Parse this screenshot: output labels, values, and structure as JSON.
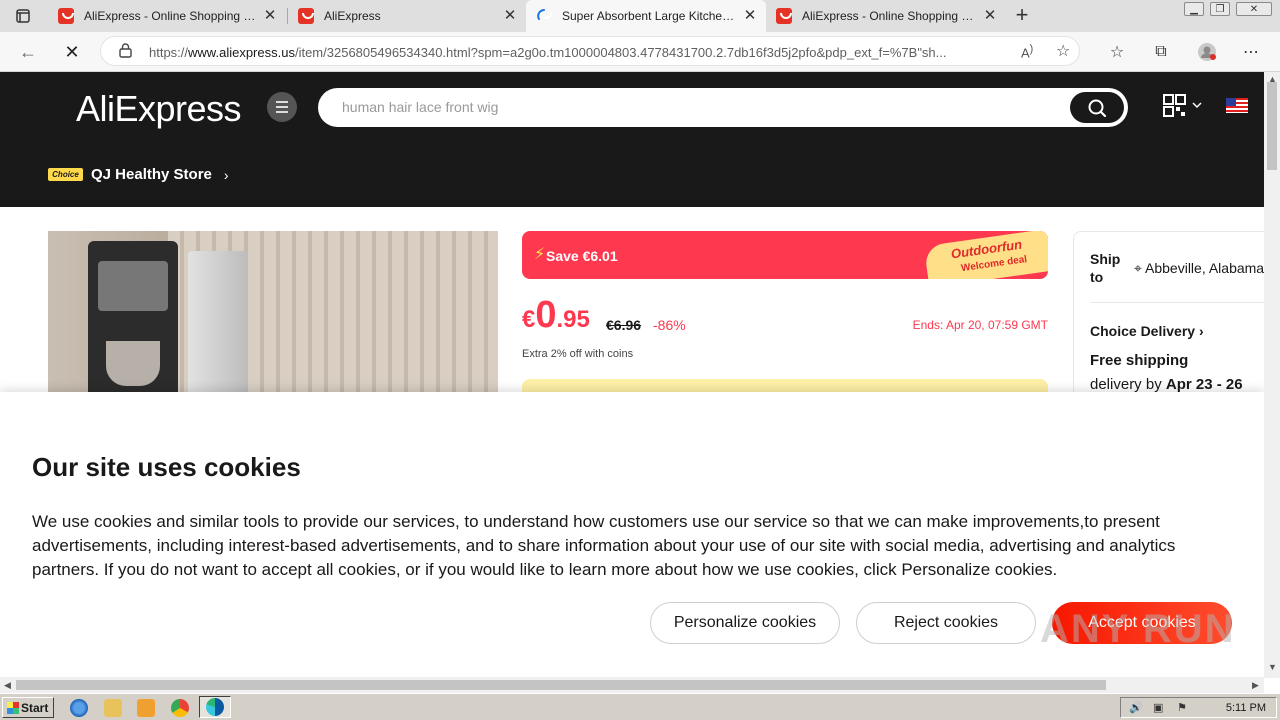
{
  "browser": {
    "tabs": [
      {
        "title": "AliExpress - Online Shopping for Popular Electronics",
        "active": false
      },
      {
        "title": "AliExpress",
        "active": false
      },
      {
        "title": "Super Absorbent Large Kitchen Absorbent Mat",
        "active": true
      },
      {
        "title": "AliExpress - Online Shopping for Popular Electronics",
        "active": false
      }
    ],
    "url_prefix": "https://",
    "url_domain": "www.aliexpress.us",
    "url_rest": "/item/3256805496534340.html?spm=a2g0o.tm1000004803.4778431700.2.7db16f3d5j2pfo&pdp_ext_f=%7B\"sh..."
  },
  "header": {
    "logo": "AliExpress",
    "search_placeholder": "human hair lace front wig",
    "store_badge": "Choice",
    "store_name": "QJ Healthy Store"
  },
  "product": {
    "save_text": "Save €6.01",
    "deal_line1": "Outdoorfun",
    "deal_line2": "Welcome deal",
    "price_currency": "€",
    "price_int": "0",
    "price_dec": ".95",
    "price_old": "€6.96",
    "discount": "-86%",
    "ends": "Ends: Apr 20, 07:59 GMT",
    "coins": "Extra 2% off with coins"
  },
  "shipping": {
    "ship_to_label": "Ship to",
    "location": "Abbeville, Alabama",
    "choice_delivery": "Choice Delivery",
    "free_shipping": "Free shipping",
    "delivery_prefix": "delivery by ",
    "delivery_dates": "Apr 23 - 26"
  },
  "cookie": {
    "title": "Our site uses cookies",
    "body": "We use cookies and similar tools to provide our services, to understand how customers use our service so that we can make improvements,to present advertisements, including interest-based advertisements, and to share information about your use of our site with social media, advertising and analytics partners. If you do not want to accept all cookies, or if you would like to learn more about how we use cookies, click Personalize cookies.",
    "personalize": "Personalize cookies",
    "reject": "Reject cookies",
    "accept": "Accept cookies"
  },
  "watermark": "ANY RUN",
  "taskbar": {
    "start": "Start",
    "clock": "5:11 PM"
  }
}
